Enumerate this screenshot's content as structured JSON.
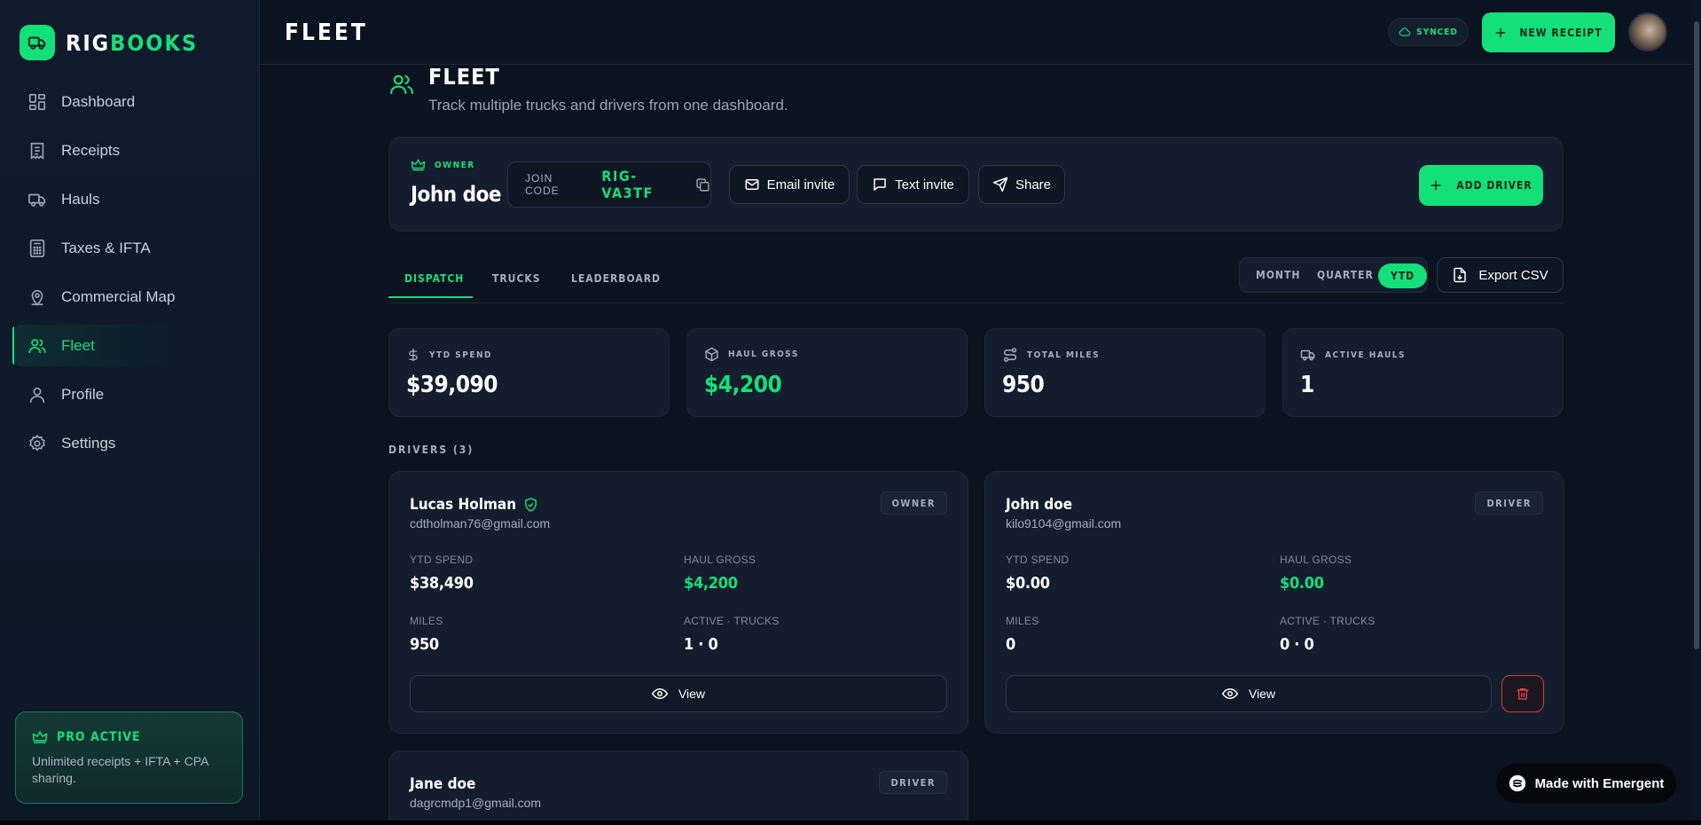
{
  "brand": {
    "name_a": "RIG",
    "name_b": "BOOKS"
  },
  "sidebar": {
    "items": [
      {
        "label": "Dashboard",
        "icon": "dashboard-icon"
      },
      {
        "label": "Receipts",
        "icon": "receipt-icon"
      },
      {
        "label": "Hauls",
        "icon": "truck-icon"
      },
      {
        "label": "Taxes & IFTA",
        "icon": "calculator-icon"
      },
      {
        "label": "Commercial Map",
        "icon": "map-pin-icon"
      },
      {
        "label": "Fleet",
        "icon": "users-icon",
        "active": true
      },
      {
        "label": "Profile",
        "icon": "user-icon"
      },
      {
        "label": "Settings",
        "icon": "gear-icon"
      }
    ],
    "pro": {
      "title": "PRO ACTIVE",
      "description": "Unlimited receipts + IFTA + CPA sharing."
    }
  },
  "topbar": {
    "title": "FLEET",
    "synced": "SYNCED",
    "new_receipt": "NEW RECEIPT"
  },
  "page": {
    "title": "FLEET",
    "subtitle": "Track multiple trucks and drivers from one dashboard."
  },
  "owner_card": {
    "role_label": "OWNER",
    "name": "John doe",
    "join_label": "JOIN CODE",
    "join_code": "RIG-VA3TF",
    "email_invite": "Email invite",
    "text_invite": "Text invite",
    "share": "Share",
    "add_driver": "ADD DRIVER"
  },
  "tabs": [
    "DISPATCH",
    "TRUCKS",
    "LEADERBOARD"
  ],
  "period": {
    "options": [
      "MONTH",
      "QUARTER",
      "YTD"
    ],
    "selected": "YTD"
  },
  "export_label": "Export CSV",
  "stats": [
    {
      "label": "YTD SPEND",
      "value": "$39,090"
    },
    {
      "label": "HAUL GROSS",
      "value": "$4,200"
    },
    {
      "label": "TOTAL MILES",
      "value": "950"
    },
    {
      "label": "ACTIVE HAULS",
      "value": "1"
    }
  ],
  "drivers_heading": "DRIVERS (3)",
  "drivers": [
    {
      "name": "Lucas Holman",
      "email": "cdtholman76@gmail.com",
      "role": "OWNER",
      "verified": true,
      "ytd_spend_label": "YTD SPEND",
      "ytd_spend": "$38,490",
      "haul_gross_label": "HAUL GROSS",
      "haul_gross": "$4,200",
      "miles_label": "MILES",
      "miles": "950",
      "active_label": "ACTIVE · TRUCKS",
      "active": "1 · 0",
      "view": "View"
    },
    {
      "name": "John doe",
      "email": "kilo9104@gmail.com",
      "role": "DRIVER",
      "ytd_spend_label": "YTD SPEND",
      "ytd_spend": "$0.00",
      "haul_gross_label": "HAUL GROSS",
      "haul_gross": "$0.00",
      "miles_label": "MILES",
      "miles": "0",
      "active_label": "ACTIVE · TRUCKS",
      "active": "0 · 0",
      "view": "View"
    },
    {
      "name": "Jane doe",
      "email": "dagrcmdp1@gmail.com",
      "role": "DRIVER"
    }
  ],
  "made_with": "Made with Emergent",
  "colors": {
    "accent": "#14e07a",
    "background": "#0b1220",
    "card": "#131d2d",
    "danger": "#ef4444"
  }
}
